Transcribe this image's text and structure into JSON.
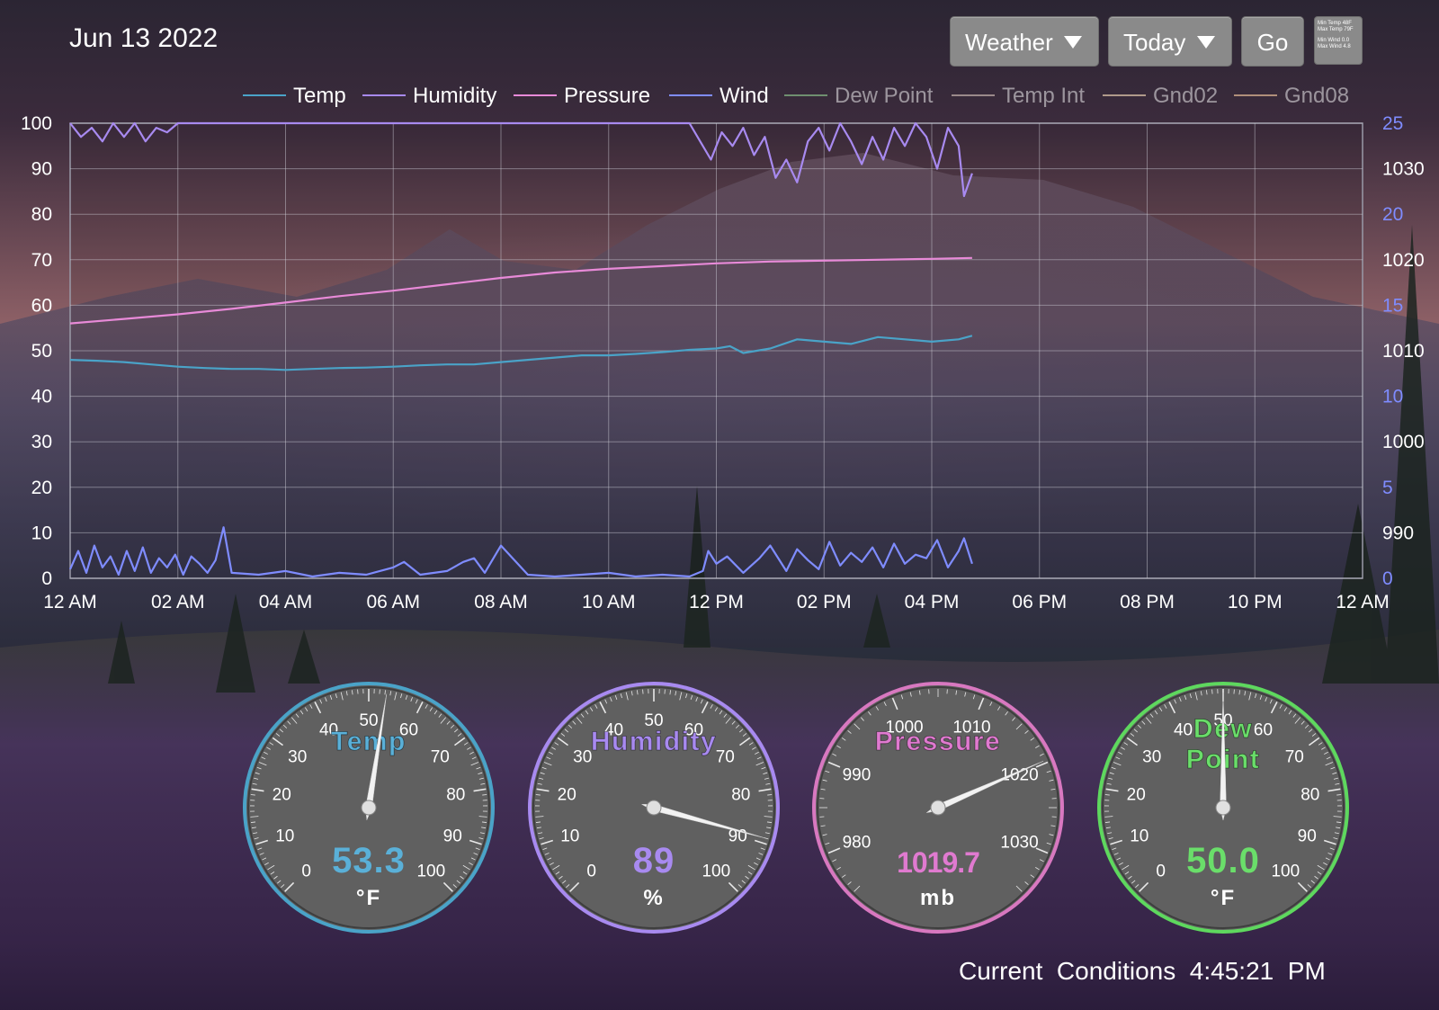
{
  "header": {
    "date": "Jun 13 2022",
    "view_select": "Weather",
    "range_select": "Today",
    "go_label": "Go",
    "summary": {
      "min_temp_label": "Min Temp",
      "min_temp": "48F",
      "max_temp_label": "Max Temp",
      "max_temp": "79F",
      "min_wind_label": "Min Wind",
      "min_wind": "0.0",
      "max_wind_label": "Max Wind",
      "max_wind": "4.8"
    }
  },
  "legend": [
    {
      "name": "Temp",
      "color": "#4aa3c8",
      "active": true
    },
    {
      "name": "Humidity",
      "color": "#a88af0",
      "active": true
    },
    {
      "name": "Pressure",
      "color": "#e88ad8",
      "active": true
    },
    {
      "name": "Wind",
      "color": "#7f8cff",
      "active": true
    },
    {
      "name": "Dew Point",
      "color": "#6f8f6f",
      "active": false
    },
    {
      "name": "Temp Int",
      "color": "#9a8a8a",
      "active": false
    },
    {
      "name": "Gnd02",
      "color": "#b09a8a",
      "active": false
    },
    {
      "name": "Gnd08",
      "color": "#b08f7a",
      "active": false
    }
  ],
  "chart_data": {
    "type": "line",
    "x_ticks": [
      "12 AM",
      "02 AM",
      "04 AM",
      "06 AM",
      "08 AM",
      "10 AM",
      "12 PM",
      "02 PM",
      "04 PM",
      "06 PM",
      "08 PM",
      "10 PM",
      "12 AM"
    ],
    "x_range_hours": [
      0,
      24
    ],
    "y_left": {
      "ticks": [
        "0",
        "10",
        "20",
        "30",
        "40",
        "50",
        "60",
        "70",
        "80",
        "90",
        "100"
      ],
      "range": [
        0,
        100
      ]
    },
    "y_right_wind": {
      "ticks": [
        "0",
        "5",
        "10",
        "15",
        "20",
        "25"
      ],
      "range": [
        0,
        25
      ],
      "color": "#7f8cff"
    },
    "y_right_pressure": {
      "ticks": [
        "990",
        "1000",
        "1010",
        "1020",
        "1030"
      ],
      "range": [
        985,
        1035
      ]
    },
    "grid": true,
    "series": [
      {
        "name": "Temp",
        "axis": "left",
        "color": "#4aa3c8",
        "x": [
          0,
          0.5,
          1,
          1.5,
          2,
          2.5,
          3,
          3.5,
          4,
          4.5,
          5,
          5.5,
          6,
          6.5,
          7,
          7.5,
          8,
          8.5,
          9,
          9.5,
          10,
          10.5,
          11,
          11.5,
          12,
          12.25,
          12.5,
          13,
          13.5,
          14,
          14.5,
          15,
          15.5,
          16,
          16.5,
          16.75
        ],
        "y": [
          48,
          47.8,
          47.5,
          47,
          46.5,
          46.2,
          46,
          46,
          45.8,
          46,
          46.2,
          46.3,
          46.5,
          46.8,
          47,
          47,
          47.5,
          48,
          48.5,
          49,
          49,
          49.3,
          49.7,
          50.2,
          50.5,
          51,
          49.5,
          50.5,
          52.5,
          52,
          51.5,
          53,
          52.5,
          52,
          52.5,
          53.3
        ]
      },
      {
        "name": "Humidity",
        "axis": "left",
        "color": "#a88af0",
        "x": [
          0,
          0.2,
          0.4,
          0.6,
          0.8,
          1,
          1.2,
          1.4,
          1.6,
          1.8,
          2,
          2.2,
          3,
          4,
          5,
          6,
          7,
          8,
          8.5,
          9,
          9.5,
          10,
          10.5,
          11,
          11.5,
          11.7,
          11.9,
          12.1,
          12.3,
          12.5,
          12.7,
          12.9,
          13.1,
          13.3,
          13.5,
          13.7,
          13.9,
          14.1,
          14.3,
          14.5,
          14.7,
          14.9,
          15.1,
          15.3,
          15.5,
          15.7,
          15.9,
          16.1,
          16.3,
          16.5,
          16.6,
          16.75
        ],
        "y": [
          100,
          97,
          99,
          96,
          100,
          97,
          100,
          96,
          99,
          98,
          100,
          100,
          100,
          100,
          100,
          100,
          100,
          100,
          100,
          100,
          100,
          100,
          100,
          100,
          100,
          96,
          92,
          98,
          95,
          99,
          93,
          97,
          88,
          92,
          87,
          96,
          99,
          94,
          100,
          96,
          91,
          97,
          92,
          99,
          95,
          100,
          97,
          90,
          99,
          95,
          84,
          89
        ]
      },
      {
        "name": "Pressure",
        "axis": "right_pressure",
        "color": "#e88ad8",
        "x": [
          0,
          1,
          2,
          3,
          4,
          5,
          6,
          7,
          8,
          9,
          10,
          11,
          12,
          13,
          14,
          15,
          16,
          16.75
        ],
        "y": [
          1013,
          1013.5,
          1014,
          1014.6,
          1015.3,
          1016,
          1016.6,
          1017.3,
          1018,
          1018.6,
          1019,
          1019.3,
          1019.6,
          1019.8,
          1019.9,
          1020,
          1020.1,
          1020.2
        ]
      },
      {
        "name": "Wind",
        "axis": "right_wind",
        "color": "#7f8cff",
        "x": [
          0,
          0.15,
          0.3,
          0.45,
          0.6,
          0.75,
          0.9,
          1.05,
          1.2,
          1.35,
          1.5,
          1.65,
          1.8,
          1.95,
          2.1,
          2.25,
          2.4,
          2.55,
          2.7,
          2.85,
          3,
          3.5,
          4,
          4.5,
          5,
          5.5,
          6,
          6.2,
          6.5,
          7,
          7.3,
          7.5,
          7.7,
          8,
          8.5,
          9,
          9.5,
          10,
          10.5,
          11,
          11.5,
          11.75,
          11.85,
          12,
          12.2,
          12.5,
          12.8,
          13,
          13.3,
          13.5,
          13.7,
          13.9,
          14.1,
          14.3,
          14.5,
          14.7,
          14.9,
          15.1,
          15.3,
          15.5,
          15.7,
          15.9,
          16.1,
          16.3,
          16.5,
          16.6,
          16.75
        ],
        "y": [
          0.5,
          1.5,
          0.3,
          1.8,
          0.6,
          1.2,
          0.2,
          1.5,
          0.4,
          1.7,
          0.3,
          1.1,
          0.6,
          1.3,
          0.2,
          1.2,
          0.8,
          0.3,
          1.0,
          2.8,
          0.3,
          0.2,
          0.4,
          0.1,
          0.3,
          0.2,
          0.6,
          0.9,
          0.2,
          0.4,
          0.9,
          1.1,
          0.3,
          1.8,
          0.2,
          0.1,
          0.2,
          0.3,
          0.1,
          0.2,
          0.1,
          0.4,
          1.5,
          0.8,
          1.2,
          0.3,
          1.1,
          1.8,
          0.4,
          1.6,
          1.0,
          0.5,
          2.0,
          0.7,
          1.4,
          0.9,
          1.7,
          0.6,
          1.9,
          0.8,
          1.3,
          1.1,
          2.1,
          0.6,
          1.5,
          2.2,
          0.8
        ]
      }
    ]
  },
  "gauges": [
    {
      "id": "temp",
      "title": "Temp",
      "value": "53.3",
      "value_num": 53.3,
      "unit": "°F",
      "min": 0,
      "max": 100,
      "color": "#4aa3c8",
      "text_color": "#5ab0d8",
      "ticks": [
        "0",
        "10",
        "20",
        "30",
        "40",
        "50",
        "60",
        "70",
        "80",
        "90",
        "100"
      ]
    },
    {
      "id": "humidity",
      "title": "Humidity",
      "value": "89",
      "value_num": 89,
      "unit": "%",
      "min": 0,
      "max": 100,
      "color": "#a88af0",
      "text_color": "#a88af0",
      "ticks": [
        "0",
        "10",
        "20",
        "30",
        "40",
        "50",
        "60",
        "70",
        "80",
        "90",
        "100"
      ]
    },
    {
      "id": "pressure",
      "title": "Pressure",
      "value": "1019.7",
      "value_num": 1019.7,
      "unit": "mb",
      "min": 975,
      "max": 1035,
      "color": "#d878c0",
      "text_color": "#e07ad0",
      "ticks": [
        "980",
        "990",
        "1000",
        "1010",
        "1020",
        "1030"
      ]
    },
    {
      "id": "dewpoint",
      "title": "Dew Point",
      "title_lines": [
        "Dew",
        "Point"
      ],
      "value": "50.0",
      "value_num": 50.0,
      "unit": "°F",
      "min": 0,
      "max": 100,
      "color": "#5ed85e",
      "text_color": "#6ade6a",
      "ticks": [
        "0",
        "10",
        "20",
        "30",
        "40",
        "50",
        "60",
        "70",
        "80",
        "90",
        "100"
      ]
    }
  ],
  "status": {
    "label": "Current  Conditions",
    "time": "4:45:21  PM"
  }
}
